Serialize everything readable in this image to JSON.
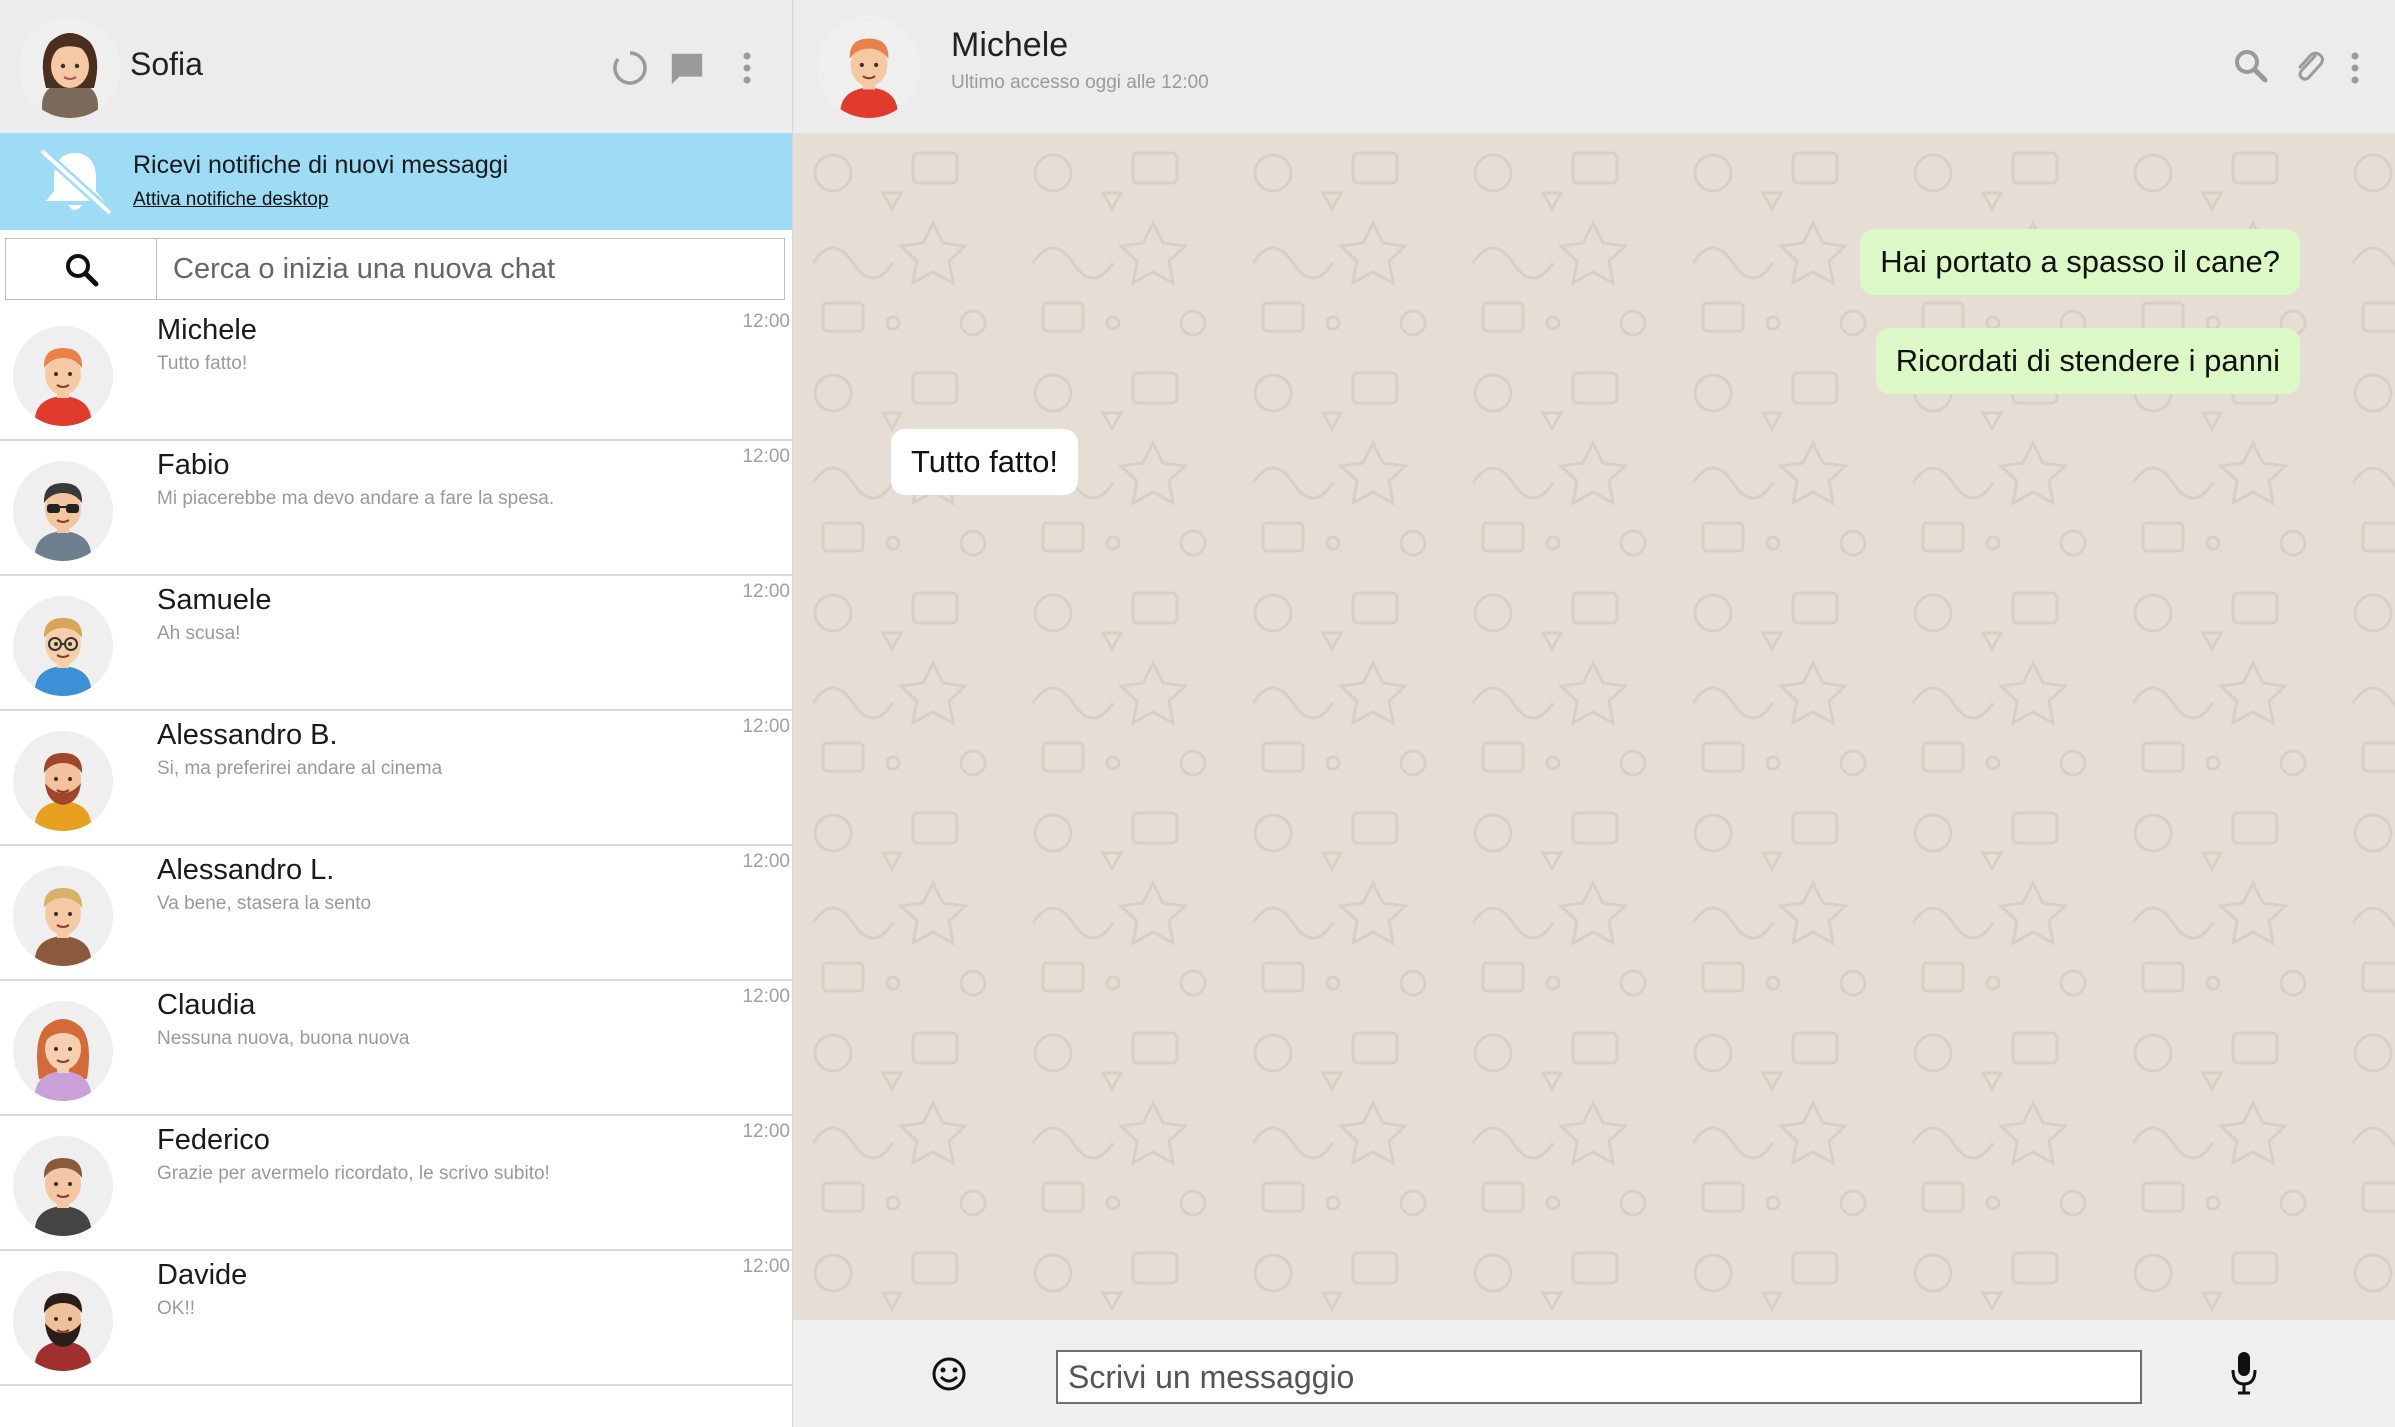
{
  "me": {
    "name": "Sofia"
  },
  "notification": {
    "title": "Ricevi notifiche di nuovi messaggi",
    "link": "Attiva notifiche desktop"
  },
  "search": {
    "placeholder": "Cerca o inizia una nuova chat"
  },
  "icons": {
    "status": "status-icon",
    "new_chat": "chat-icon",
    "menu": "menu-dots-icon",
    "search": "search-icon",
    "attach": "paperclip-icon",
    "emoji": "emoji-icon",
    "mic": "microphone-icon",
    "notifications": "bell-off-icon"
  },
  "chats": [
    {
      "name": "Michele",
      "preview": "Tutto fatto!",
      "time": "12:00"
    },
    {
      "name": "Fabio",
      "preview": "Mi piacerebbe ma devo andare a fare la spesa.",
      "time": "12:00"
    },
    {
      "name": "Samuele",
      "preview": "Ah scusa!",
      "time": "12:00"
    },
    {
      "name": "Alessandro B.",
      "preview": "Si, ma preferirei andare al cinema",
      "time": "12:00"
    },
    {
      "name": "Alessandro L.",
      "preview": "Va bene, stasera la sento",
      "time": "12:00"
    },
    {
      "name": "Claudia",
      "preview": "Nessuna nuova, buona nuova",
      "time": "12:00"
    },
    {
      "name": "Federico",
      "preview": "Grazie per avermelo ricordato, le scrivo subito!",
      "time": "12:00"
    },
    {
      "name": "Davide",
      "preview": "OK!!",
      "time": "12:00"
    }
  ],
  "active_chat": {
    "name": "Michele",
    "status": "Ultimo accesso oggi alle 12:00",
    "messages": [
      {
        "text": "Hai portato a spasso il cane?",
        "type": "sent"
      },
      {
        "text": "Ricordati di stendere i panni",
        "type": "sent"
      },
      {
        "text": "Tutto fatto!",
        "type": "received"
      }
    ]
  },
  "composer": {
    "placeholder": "Scrivi un messaggio"
  },
  "colors": {
    "header_bg": "#ececec",
    "notification_bg": "#9edcf6",
    "chat_bg": "#e6ddd4",
    "sent_bubble": "#dcf8c6",
    "received_bubble": "#ffffff"
  }
}
